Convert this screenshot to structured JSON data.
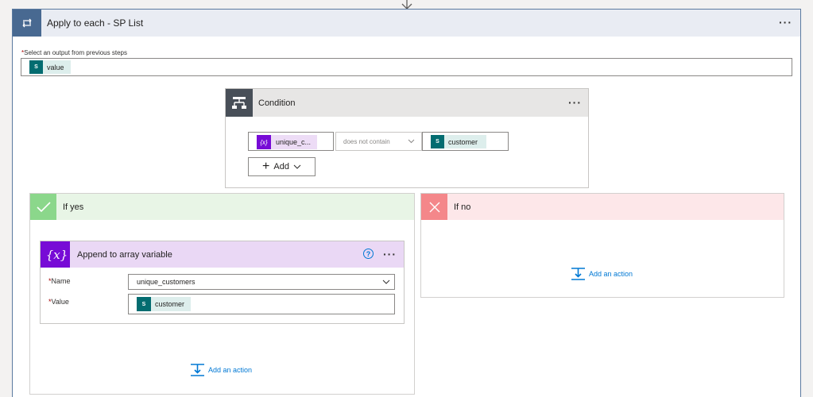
{
  "loop": {
    "title": "Apply to each - SP List",
    "more_label": "···",
    "output_label_star": "*",
    "output_label": "Select an output from previous steps",
    "output_token": "value"
  },
  "condition": {
    "title": "Condition",
    "more_label": "···",
    "left_token": "unique_c...",
    "operator": "does not contain",
    "right_token": "customer",
    "add_label": "Add"
  },
  "if_yes": {
    "title": "If yes",
    "append": {
      "title": "Append to array variable",
      "help_label": "?",
      "more_label": "···",
      "name_label": "Name",
      "name_value": "unique_customers",
      "value_label": "Value",
      "value_token": "customer",
      "required_star": "*"
    },
    "add_action_label": "Add an action"
  },
  "if_no": {
    "title": "If no",
    "add_action_label": "Add an action"
  },
  "icons": {
    "loop": "loop-icon",
    "condition": "condition-icon",
    "sharepoint": "sharepoint-icon",
    "variable": "variable-icon",
    "check": "check-icon",
    "x": "close-icon",
    "add_action": "add-action-icon"
  },
  "colors": {
    "loop_accent": "#486991",
    "condition_accent": "#484f58",
    "variable_accent": "#770bd6",
    "sharepoint_accent": "#036c70",
    "yes_accent": "#8bd78b",
    "no_accent": "#f4878a",
    "link": "#0078d4"
  }
}
